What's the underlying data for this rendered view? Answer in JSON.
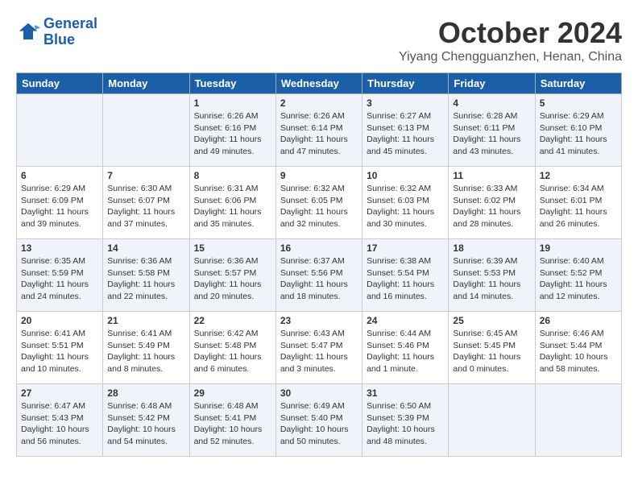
{
  "header": {
    "logo_line1": "General",
    "logo_line2": "Blue",
    "month_title": "October 2024",
    "location": "Yiyang Chengguanzhen, Henan, China"
  },
  "days_of_week": [
    "Sunday",
    "Monday",
    "Tuesday",
    "Wednesday",
    "Thursday",
    "Friday",
    "Saturday"
  ],
  "weeks": [
    [
      {
        "day": "",
        "info": ""
      },
      {
        "day": "",
        "info": ""
      },
      {
        "day": "1",
        "info": "Sunrise: 6:26 AM\nSunset: 6:16 PM\nDaylight: 11 hours and 49 minutes."
      },
      {
        "day": "2",
        "info": "Sunrise: 6:26 AM\nSunset: 6:14 PM\nDaylight: 11 hours and 47 minutes."
      },
      {
        "day": "3",
        "info": "Sunrise: 6:27 AM\nSunset: 6:13 PM\nDaylight: 11 hours and 45 minutes."
      },
      {
        "day": "4",
        "info": "Sunrise: 6:28 AM\nSunset: 6:11 PM\nDaylight: 11 hours and 43 minutes."
      },
      {
        "day": "5",
        "info": "Sunrise: 6:29 AM\nSunset: 6:10 PM\nDaylight: 11 hours and 41 minutes."
      }
    ],
    [
      {
        "day": "6",
        "info": "Sunrise: 6:29 AM\nSunset: 6:09 PM\nDaylight: 11 hours and 39 minutes."
      },
      {
        "day": "7",
        "info": "Sunrise: 6:30 AM\nSunset: 6:07 PM\nDaylight: 11 hours and 37 minutes."
      },
      {
        "day": "8",
        "info": "Sunrise: 6:31 AM\nSunset: 6:06 PM\nDaylight: 11 hours and 35 minutes."
      },
      {
        "day": "9",
        "info": "Sunrise: 6:32 AM\nSunset: 6:05 PM\nDaylight: 11 hours and 32 minutes."
      },
      {
        "day": "10",
        "info": "Sunrise: 6:32 AM\nSunset: 6:03 PM\nDaylight: 11 hours and 30 minutes."
      },
      {
        "day": "11",
        "info": "Sunrise: 6:33 AM\nSunset: 6:02 PM\nDaylight: 11 hours and 28 minutes."
      },
      {
        "day": "12",
        "info": "Sunrise: 6:34 AM\nSunset: 6:01 PM\nDaylight: 11 hours and 26 minutes."
      }
    ],
    [
      {
        "day": "13",
        "info": "Sunrise: 6:35 AM\nSunset: 5:59 PM\nDaylight: 11 hours and 24 minutes."
      },
      {
        "day": "14",
        "info": "Sunrise: 6:36 AM\nSunset: 5:58 PM\nDaylight: 11 hours and 22 minutes."
      },
      {
        "day": "15",
        "info": "Sunrise: 6:36 AM\nSunset: 5:57 PM\nDaylight: 11 hours and 20 minutes."
      },
      {
        "day": "16",
        "info": "Sunrise: 6:37 AM\nSunset: 5:56 PM\nDaylight: 11 hours and 18 minutes."
      },
      {
        "day": "17",
        "info": "Sunrise: 6:38 AM\nSunset: 5:54 PM\nDaylight: 11 hours and 16 minutes."
      },
      {
        "day": "18",
        "info": "Sunrise: 6:39 AM\nSunset: 5:53 PM\nDaylight: 11 hours and 14 minutes."
      },
      {
        "day": "19",
        "info": "Sunrise: 6:40 AM\nSunset: 5:52 PM\nDaylight: 11 hours and 12 minutes."
      }
    ],
    [
      {
        "day": "20",
        "info": "Sunrise: 6:41 AM\nSunset: 5:51 PM\nDaylight: 11 hours and 10 minutes."
      },
      {
        "day": "21",
        "info": "Sunrise: 6:41 AM\nSunset: 5:49 PM\nDaylight: 11 hours and 8 minutes."
      },
      {
        "day": "22",
        "info": "Sunrise: 6:42 AM\nSunset: 5:48 PM\nDaylight: 11 hours and 6 minutes."
      },
      {
        "day": "23",
        "info": "Sunrise: 6:43 AM\nSunset: 5:47 PM\nDaylight: 11 hours and 3 minutes."
      },
      {
        "day": "24",
        "info": "Sunrise: 6:44 AM\nSunset: 5:46 PM\nDaylight: 11 hours and 1 minute."
      },
      {
        "day": "25",
        "info": "Sunrise: 6:45 AM\nSunset: 5:45 PM\nDaylight: 11 hours and 0 minutes."
      },
      {
        "day": "26",
        "info": "Sunrise: 6:46 AM\nSunset: 5:44 PM\nDaylight: 10 hours and 58 minutes."
      }
    ],
    [
      {
        "day": "27",
        "info": "Sunrise: 6:47 AM\nSunset: 5:43 PM\nDaylight: 10 hours and 56 minutes."
      },
      {
        "day": "28",
        "info": "Sunrise: 6:48 AM\nSunset: 5:42 PM\nDaylight: 10 hours and 54 minutes."
      },
      {
        "day": "29",
        "info": "Sunrise: 6:48 AM\nSunset: 5:41 PM\nDaylight: 10 hours and 52 minutes."
      },
      {
        "day": "30",
        "info": "Sunrise: 6:49 AM\nSunset: 5:40 PM\nDaylight: 10 hours and 50 minutes."
      },
      {
        "day": "31",
        "info": "Sunrise: 6:50 AM\nSunset: 5:39 PM\nDaylight: 10 hours and 48 minutes."
      },
      {
        "day": "",
        "info": ""
      },
      {
        "day": "",
        "info": ""
      }
    ]
  ]
}
